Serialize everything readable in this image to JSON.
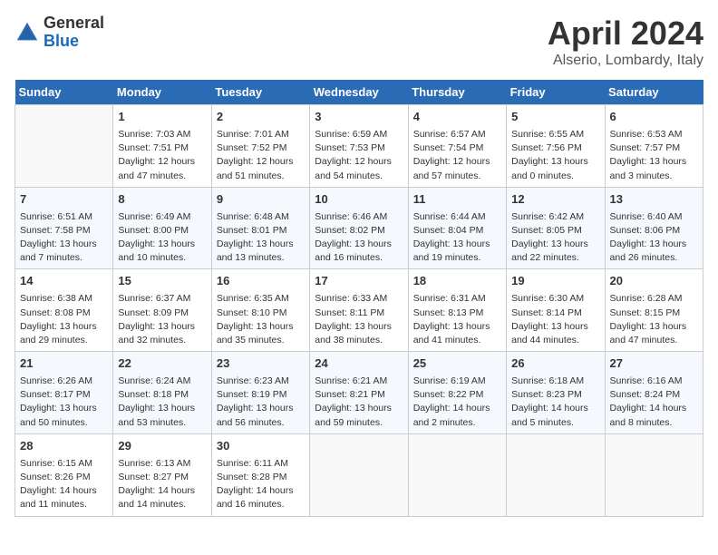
{
  "header": {
    "logo": {
      "general": "General",
      "blue": "Blue"
    },
    "title": "April 2024",
    "location": "Alserio, Lombardy, Italy"
  },
  "calendar": {
    "columns": [
      "Sunday",
      "Monday",
      "Tuesday",
      "Wednesday",
      "Thursday",
      "Friday",
      "Saturday"
    ],
    "weeks": [
      [
        {
          "day": "",
          "info": ""
        },
        {
          "day": "1",
          "info": "Sunrise: 7:03 AM\nSunset: 7:51 PM\nDaylight: 12 hours\nand 47 minutes."
        },
        {
          "day": "2",
          "info": "Sunrise: 7:01 AM\nSunset: 7:52 PM\nDaylight: 12 hours\nand 51 minutes."
        },
        {
          "day": "3",
          "info": "Sunrise: 6:59 AM\nSunset: 7:53 PM\nDaylight: 12 hours\nand 54 minutes."
        },
        {
          "day": "4",
          "info": "Sunrise: 6:57 AM\nSunset: 7:54 PM\nDaylight: 12 hours\nand 57 minutes."
        },
        {
          "day": "5",
          "info": "Sunrise: 6:55 AM\nSunset: 7:56 PM\nDaylight: 13 hours\nand 0 minutes."
        },
        {
          "day": "6",
          "info": "Sunrise: 6:53 AM\nSunset: 7:57 PM\nDaylight: 13 hours\nand 3 minutes."
        }
      ],
      [
        {
          "day": "7",
          "info": "Sunrise: 6:51 AM\nSunset: 7:58 PM\nDaylight: 13 hours\nand 7 minutes."
        },
        {
          "day": "8",
          "info": "Sunrise: 6:49 AM\nSunset: 8:00 PM\nDaylight: 13 hours\nand 10 minutes."
        },
        {
          "day": "9",
          "info": "Sunrise: 6:48 AM\nSunset: 8:01 PM\nDaylight: 13 hours\nand 13 minutes."
        },
        {
          "day": "10",
          "info": "Sunrise: 6:46 AM\nSunset: 8:02 PM\nDaylight: 13 hours\nand 16 minutes."
        },
        {
          "day": "11",
          "info": "Sunrise: 6:44 AM\nSunset: 8:04 PM\nDaylight: 13 hours\nand 19 minutes."
        },
        {
          "day": "12",
          "info": "Sunrise: 6:42 AM\nSunset: 8:05 PM\nDaylight: 13 hours\nand 22 minutes."
        },
        {
          "day": "13",
          "info": "Sunrise: 6:40 AM\nSunset: 8:06 PM\nDaylight: 13 hours\nand 26 minutes."
        }
      ],
      [
        {
          "day": "14",
          "info": "Sunrise: 6:38 AM\nSunset: 8:08 PM\nDaylight: 13 hours\nand 29 minutes."
        },
        {
          "day": "15",
          "info": "Sunrise: 6:37 AM\nSunset: 8:09 PM\nDaylight: 13 hours\nand 32 minutes."
        },
        {
          "day": "16",
          "info": "Sunrise: 6:35 AM\nSunset: 8:10 PM\nDaylight: 13 hours\nand 35 minutes."
        },
        {
          "day": "17",
          "info": "Sunrise: 6:33 AM\nSunset: 8:11 PM\nDaylight: 13 hours\nand 38 minutes."
        },
        {
          "day": "18",
          "info": "Sunrise: 6:31 AM\nSunset: 8:13 PM\nDaylight: 13 hours\nand 41 minutes."
        },
        {
          "day": "19",
          "info": "Sunrise: 6:30 AM\nSunset: 8:14 PM\nDaylight: 13 hours\nand 44 minutes."
        },
        {
          "day": "20",
          "info": "Sunrise: 6:28 AM\nSunset: 8:15 PM\nDaylight: 13 hours\nand 47 minutes."
        }
      ],
      [
        {
          "day": "21",
          "info": "Sunrise: 6:26 AM\nSunset: 8:17 PM\nDaylight: 13 hours\nand 50 minutes."
        },
        {
          "day": "22",
          "info": "Sunrise: 6:24 AM\nSunset: 8:18 PM\nDaylight: 13 hours\nand 53 minutes."
        },
        {
          "day": "23",
          "info": "Sunrise: 6:23 AM\nSunset: 8:19 PM\nDaylight: 13 hours\nand 56 minutes."
        },
        {
          "day": "24",
          "info": "Sunrise: 6:21 AM\nSunset: 8:21 PM\nDaylight: 13 hours\nand 59 minutes."
        },
        {
          "day": "25",
          "info": "Sunrise: 6:19 AM\nSunset: 8:22 PM\nDaylight: 14 hours\nand 2 minutes."
        },
        {
          "day": "26",
          "info": "Sunrise: 6:18 AM\nSunset: 8:23 PM\nDaylight: 14 hours\nand 5 minutes."
        },
        {
          "day": "27",
          "info": "Sunrise: 6:16 AM\nSunset: 8:24 PM\nDaylight: 14 hours\nand 8 minutes."
        }
      ],
      [
        {
          "day": "28",
          "info": "Sunrise: 6:15 AM\nSunset: 8:26 PM\nDaylight: 14 hours\nand 11 minutes."
        },
        {
          "day": "29",
          "info": "Sunrise: 6:13 AM\nSunset: 8:27 PM\nDaylight: 14 hours\nand 14 minutes."
        },
        {
          "day": "30",
          "info": "Sunrise: 6:11 AM\nSunset: 8:28 PM\nDaylight: 14 hours\nand 16 minutes."
        },
        {
          "day": "",
          "info": ""
        },
        {
          "day": "",
          "info": ""
        },
        {
          "day": "",
          "info": ""
        },
        {
          "day": "",
          "info": ""
        }
      ]
    ]
  }
}
